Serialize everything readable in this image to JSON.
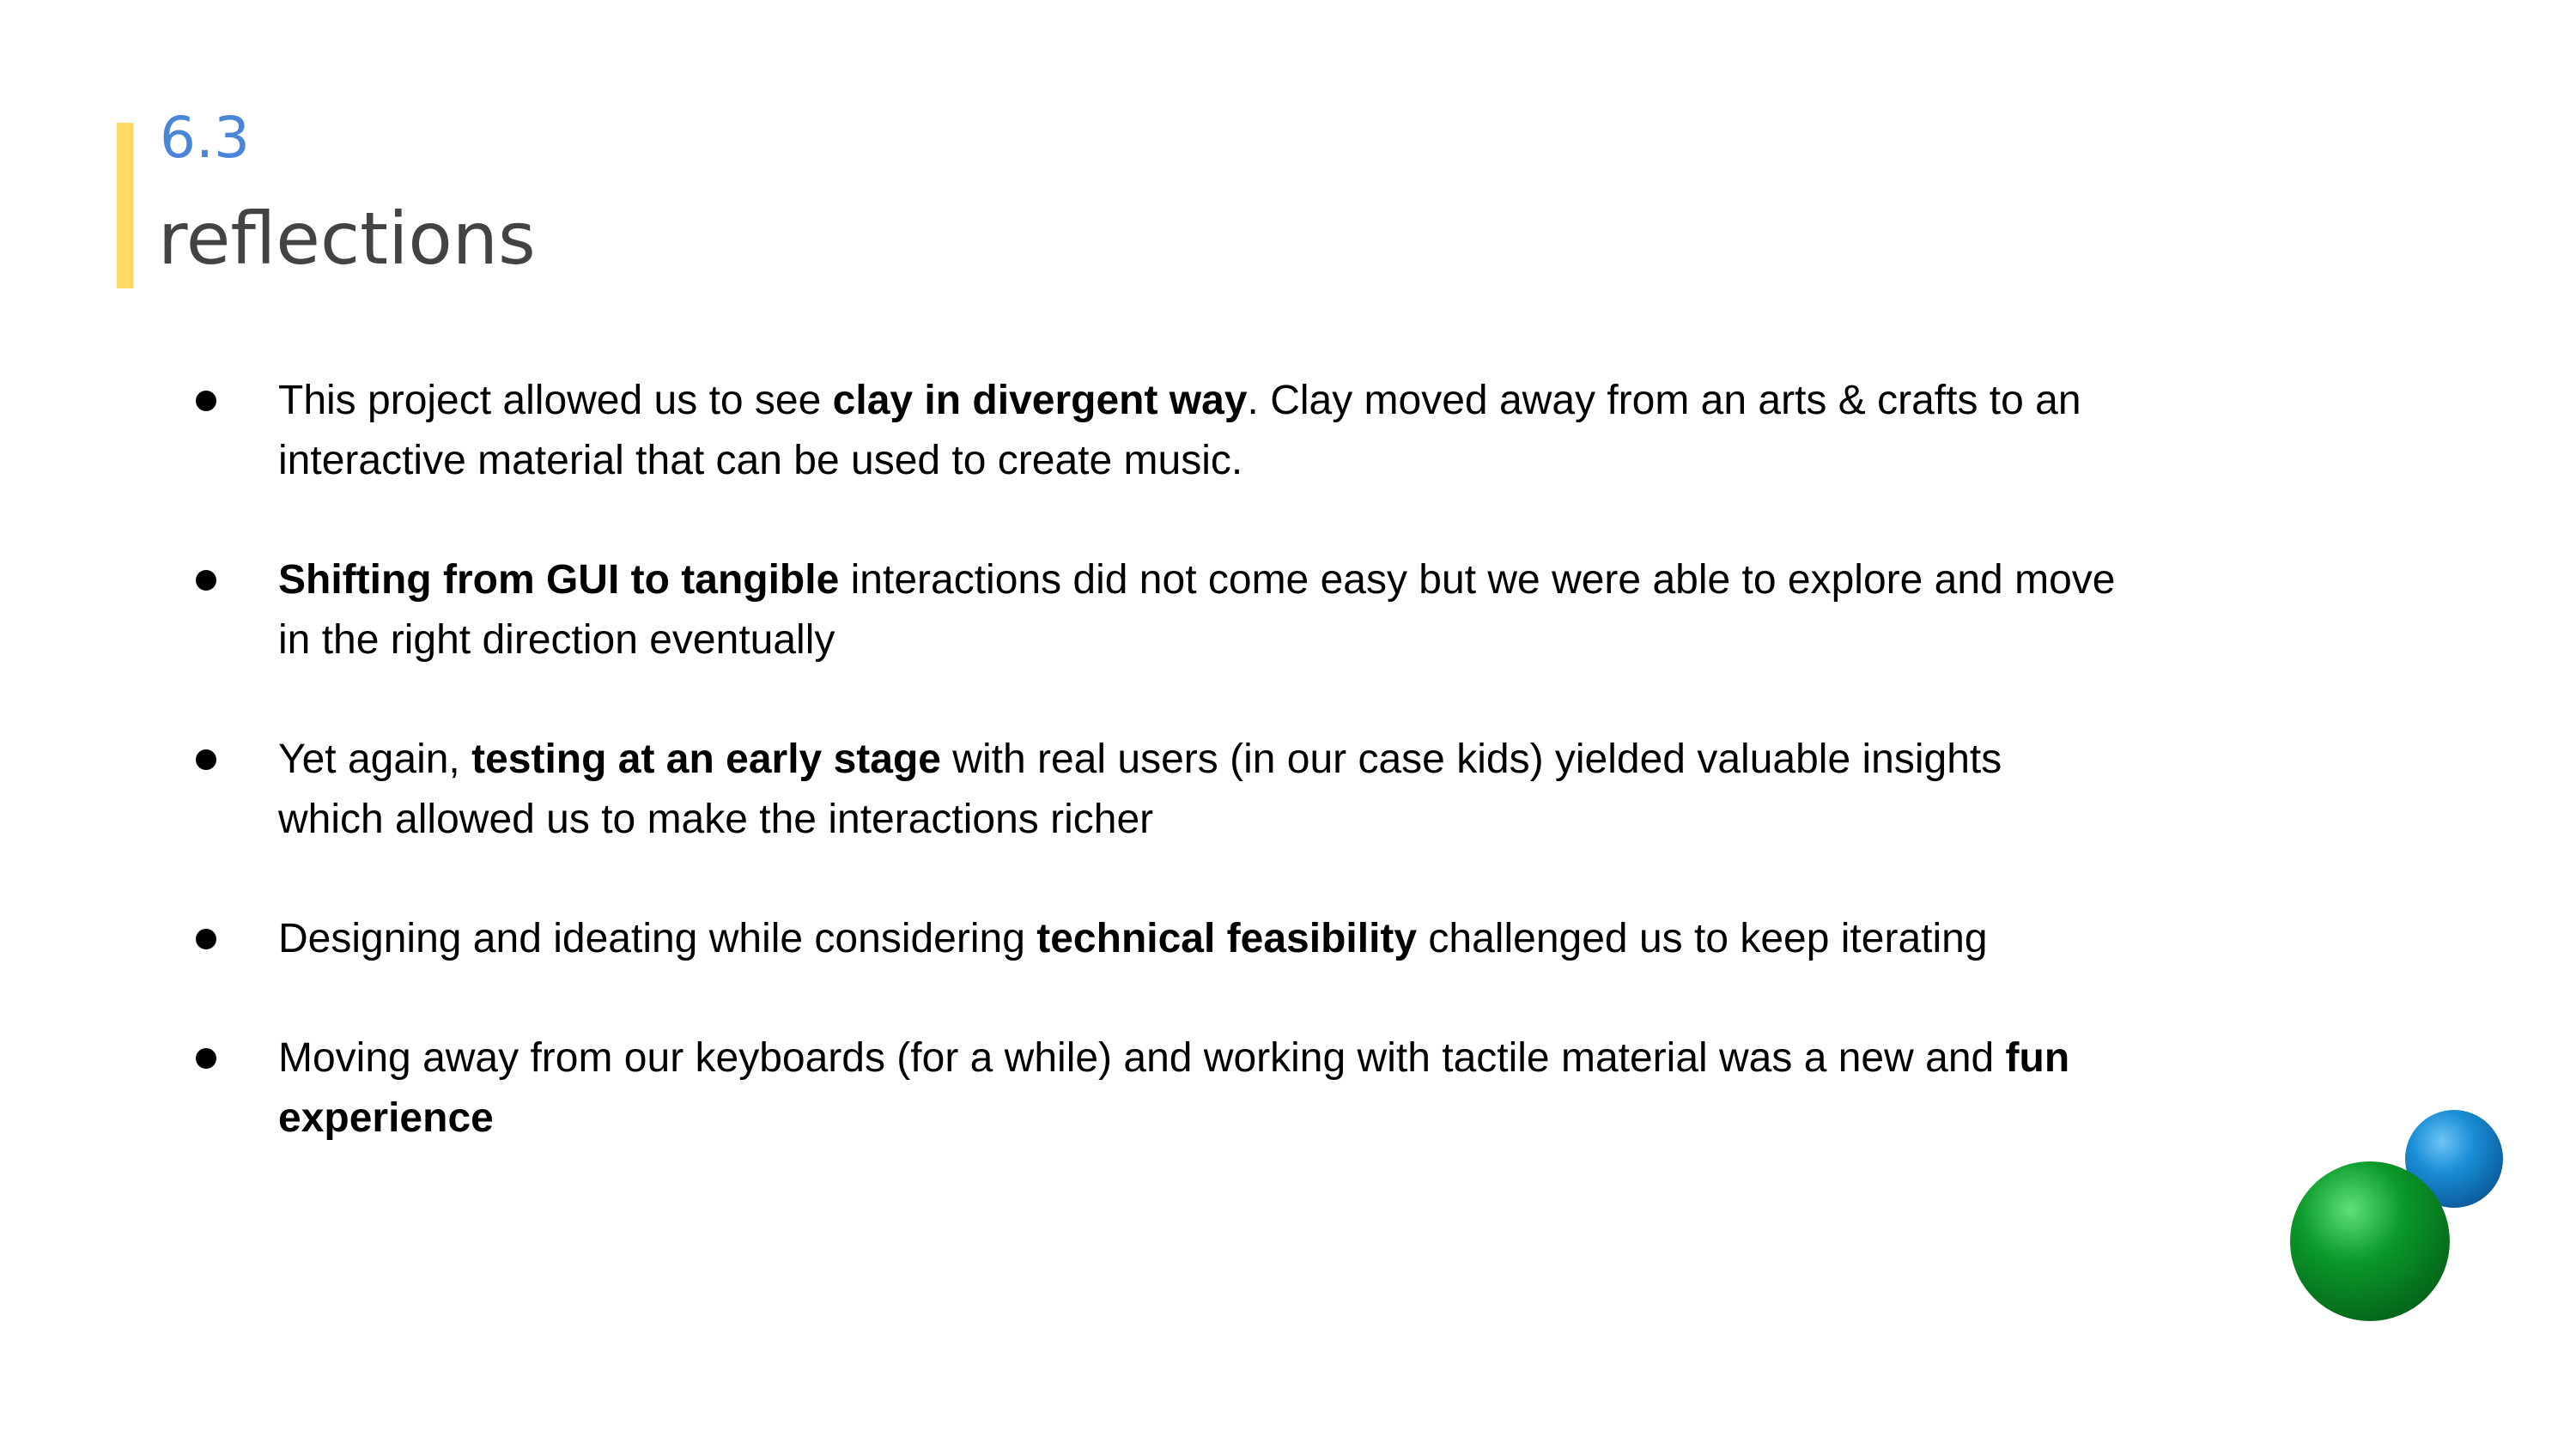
{
  "slide": {
    "section_number": "6.3",
    "title": "reflections",
    "accent_color": "#ffd966",
    "number_color": "#4a86d8",
    "title_color": "#434343"
  },
  "bullets": [
    {
      "segments": [
        {
          "text": "This project allowed us to see ",
          "bold": false
        },
        {
          "text": "clay in divergent way",
          "bold": true
        },
        {
          "text": ". Clay moved away from an arts & crafts to an interactive material that can be used to create music.",
          "bold": false
        }
      ]
    },
    {
      "segments": [
        {
          "text": "Shifting from GUI to tangible",
          "bold": true
        },
        {
          "text": " interactions did not come easy but we were able to explore and move in the right direction eventually",
          "bold": false
        }
      ]
    },
    {
      "segments": [
        {
          "text": "Yet again, ",
          "bold": false
        },
        {
          "text": "testing at an early stage",
          "bold": true
        },
        {
          "text": " with real users (in our case kids) yielded valuable insights which allowed us to make the interactions richer",
          "bold": false
        }
      ]
    },
    {
      "segments": [
        {
          "text": "Designing and ideating while considering ",
          "bold": false
        },
        {
          "text": "technical feasibility",
          "bold": true
        },
        {
          "text": " challenged us to keep iterating",
          "bold": false
        }
      ]
    },
    {
      "segments": [
        {
          "text": "Moving away from our keyboards (for a while) and working with tactile material was a new and ",
          "bold": false
        },
        {
          "text": "fun experience",
          "bold": true
        }
      ]
    }
  ],
  "decoration": {
    "icon": "clay-balls-icon",
    "colors": {
      "green": "#0a9a2a",
      "blue": "#1a8fd6"
    }
  }
}
